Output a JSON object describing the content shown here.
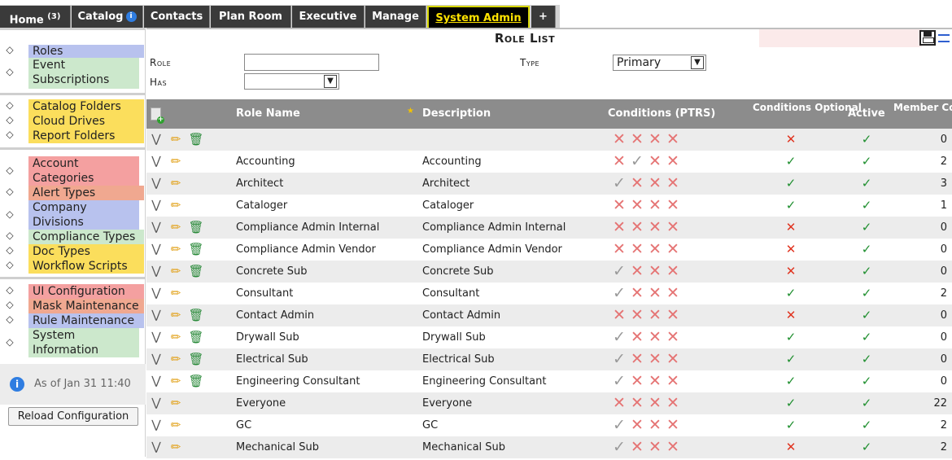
{
  "tabs": [
    {
      "label": "Home",
      "badge": "(3)"
    },
    {
      "label": "Catalog",
      "badge": "i"
    },
    {
      "label": "Contacts"
    },
    {
      "label": "Plan Room"
    },
    {
      "label": "Executive"
    },
    {
      "label": "Manage"
    },
    {
      "label": "System Admin",
      "active": true
    },
    {
      "label": "+"
    }
  ],
  "sidebar": {
    "items": [
      {
        "label": "Roles",
        "color": "blue"
      },
      {
        "label": "Event Subscriptions",
        "color": "green"
      },
      {
        "label": "Catalog Folders",
        "color": "yellow"
      },
      {
        "label": "Cloud Drives",
        "color": "yellow"
      },
      {
        "label": "Report Folders",
        "color": "yellow"
      },
      {
        "label": "Account Categories",
        "color": "red"
      },
      {
        "label": "Alert Types",
        "color": "salmon"
      },
      {
        "label": "Company Divisions",
        "color": "blue"
      },
      {
        "label": "Compliance Types",
        "color": "green"
      },
      {
        "label": "Doc Types",
        "color": "yellow"
      },
      {
        "label": "Workflow Scripts",
        "color": "yellow"
      },
      {
        "label": "UI Configuration",
        "color": "red"
      },
      {
        "label": "Mask Maintenance",
        "color": "salmon"
      },
      {
        "label": "Rule Maintenance",
        "color": "blue"
      },
      {
        "label": "System Information",
        "color": "green"
      }
    ],
    "status_text": "As of Jan 31 11:40",
    "reload_label": "Reload Configuration"
  },
  "main": {
    "title": "Role List",
    "filters": {
      "role_label": "Role",
      "role_value": "",
      "type_label": "Type",
      "type_value": "Primary",
      "has_label": "Has",
      "has_value": ""
    },
    "columns": {
      "role_name": "Role Name",
      "description": "Description",
      "conditions": "Conditions (PTRS)",
      "conditions_optional": "Conditions Optional",
      "active": "Active",
      "member_count": "Member Count"
    },
    "rows": [
      {
        "name": "",
        "description": "",
        "ptrs": "XXXX",
        "optional": false,
        "active": true,
        "count": "0",
        "trash": true
      },
      {
        "name": "Accounting",
        "description": "Accounting",
        "ptrs": "XVXX",
        "optional": true,
        "active": true,
        "count": "2",
        "trash": false
      },
      {
        "name": "Architect",
        "description": "Architect",
        "ptrs": "VXXX",
        "optional": true,
        "active": true,
        "count": "3",
        "trash": false
      },
      {
        "name": "Cataloger",
        "description": "Cataloger",
        "ptrs": "XXXX",
        "optional": true,
        "active": true,
        "count": "1",
        "trash": false
      },
      {
        "name": "Compliance Admin Internal",
        "description": "Compliance Admin Internal",
        "ptrs": "XXXX",
        "optional": false,
        "active": true,
        "count": "0",
        "trash": true
      },
      {
        "name": "Compliance Admin Vendor",
        "description": "Compliance Admin Vendor",
        "ptrs": "XXXX",
        "optional": false,
        "active": true,
        "count": "0",
        "trash": true
      },
      {
        "name": "Concrete Sub",
        "description": "Concrete Sub",
        "ptrs": "VXXX",
        "optional": false,
        "active": true,
        "count": "0",
        "trash": true
      },
      {
        "name": "Consultant",
        "description": "Consultant",
        "ptrs": "VXXX",
        "optional": true,
        "active": true,
        "count": "2",
        "trash": false
      },
      {
        "name": "Contact Admin",
        "description": "Contact Admin",
        "ptrs": "XXXX",
        "optional": false,
        "active": true,
        "count": "0",
        "trash": true
      },
      {
        "name": "Drywall Sub",
        "description": "Drywall Sub",
        "ptrs": "VXXX",
        "optional": true,
        "active": true,
        "count": "0",
        "trash": true
      },
      {
        "name": "Electrical Sub",
        "description": "Electrical Sub",
        "ptrs": "VXXX",
        "optional": true,
        "active": true,
        "count": "0",
        "trash": true
      },
      {
        "name": "Engineering Consultant",
        "description": "Engineering Consultant",
        "ptrs": "VXXX",
        "optional": true,
        "active": true,
        "count": "0",
        "trash": true
      },
      {
        "name": "Everyone",
        "description": "Everyone",
        "ptrs": "XXXX",
        "optional": true,
        "active": true,
        "count": "22",
        "trash": false
      },
      {
        "name": "GC",
        "description": "GC",
        "ptrs": "VXXX",
        "optional": true,
        "active": true,
        "count": "2",
        "trash": false
      },
      {
        "name": "Mechanical Sub",
        "description": "Mechanical Sub",
        "ptrs": "VXXX",
        "optional": false,
        "active": true,
        "count": "2",
        "trash": false
      }
    ]
  }
}
